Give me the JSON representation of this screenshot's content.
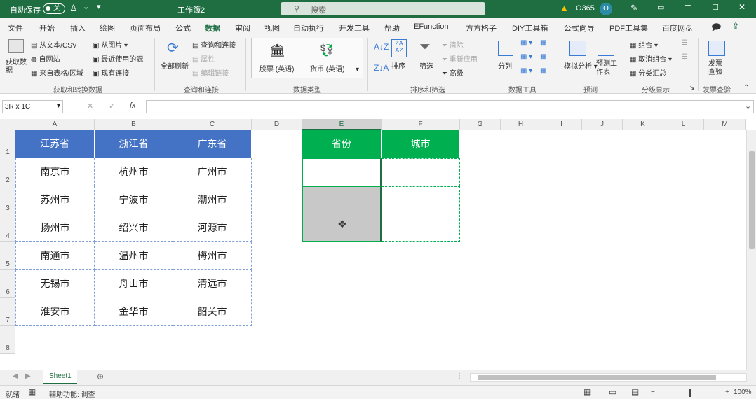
{
  "titlebar": {
    "autosave_label": "自动保存",
    "autosave_state": "关",
    "doc_title": "工作簿2",
    "search_placeholder": "搜索",
    "account": "O365",
    "avatar_initial": "O"
  },
  "menu": {
    "items": [
      "文件",
      "开始",
      "插入",
      "绘图",
      "页面布局",
      "公式",
      "数据",
      "审阅",
      "视图",
      "自动执行",
      "开发工具",
      "帮助",
      "EFunction",
      "方方格子",
      "DIY工具箱",
      "公式向导",
      "PDF工具集",
      "百度网盘"
    ],
    "active_index": 6
  },
  "ribbon": {
    "get_data": "获取数据",
    "from_text": "从文本/CSV",
    "from_web": "自网站",
    "from_table": "来自表格/区域",
    "from_picture": "从图片",
    "recent_sources": "最近使用的源",
    "existing_conn": "现有连接",
    "refresh_all": "全部刷新",
    "queries_conn": "查询和连接",
    "properties": "属性",
    "edit_links": "编辑链接",
    "stocks": "股票 (英语)",
    "currency": "货币 (英语)",
    "sort": "排序",
    "filter": "筛选",
    "clear": "清除",
    "reapply": "重新应用",
    "advanced": "高级",
    "text_to_columns": "分列",
    "whatif": "模拟分析",
    "forecast_sheet": "预测工作表",
    "group": "组合",
    "ungroup": "取消组合",
    "subtotal": "分类汇总",
    "invoice_check": "发票查验",
    "groups": {
      "get_transform": "获取和转换数据",
      "queries": "查询和连接",
      "data_types": "数据类型",
      "sort_filter": "排序和筛选",
      "data_tools": "数据工具",
      "forecast": "预测",
      "outline": "分级显示",
      "invoice": "发票查验"
    }
  },
  "formula_bar": {
    "name_box": "3R x 1C",
    "fx": "fx",
    "value": ""
  },
  "sheet": {
    "columns": [
      "A",
      "B",
      "C",
      "D",
      "E",
      "F",
      "G",
      "H",
      "I",
      "J",
      "K",
      "L",
      "M"
    ],
    "rows": [
      "1",
      "2",
      "3",
      "4",
      "5",
      "6",
      "7",
      "8"
    ],
    "left_table": {
      "headers": [
        "江苏省",
        "浙江省",
        "广东省"
      ],
      "rows": [
        [
          "南京市",
          "杭州市",
          "广州市"
        ],
        [
          "苏州市",
          "宁波市",
          "潮州市"
        ],
        [
          "扬州市",
          "绍兴市",
          "河源市"
        ],
        [
          "南通市",
          "温州市",
          "梅州市"
        ],
        [
          "无锡市",
          "舟山市",
          "清远市"
        ],
        [
          "淮安市",
          "金华市",
          "韶关市"
        ]
      ]
    },
    "right_table": {
      "headers": [
        "省份",
        "城市"
      ]
    }
  },
  "tabs": {
    "sheet1": "Sheet1"
  },
  "status": {
    "ready": "就绪",
    "accessibility": "辅助功能: 调查",
    "zoom": "100%"
  },
  "colors": {
    "title_bg": "#1e6e42",
    "table_blue": "#4472c4",
    "table_green": "#00b050"
  }
}
